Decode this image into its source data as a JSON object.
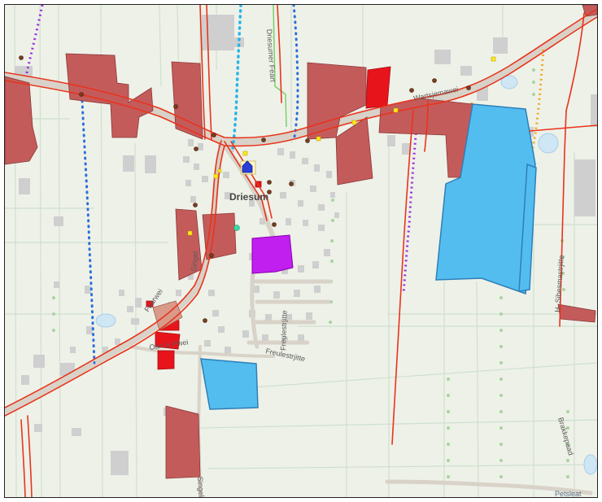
{
  "map": {
    "labels": {
      "town": "Driesum",
      "driesumer_feart": "Driesumer Feart",
      "singel_upper": "Singel",
      "singel_lower": "Singel",
      "foarwei": "Foarwei",
      "oanrein": "Oan 'e Pwei",
      "freulestrjitte": "Freulestrjitte",
      "wartsjemawei": "Wartsjemawei",
      "sibesmastrjitte": "H. Sibesmastrjitte",
      "brakkepaad": "Brakkepaad",
      "petsleat": "Petsleat"
    },
    "colors": {
      "background": "#eef1e8",
      "field_lines": "#cfe0cd",
      "road_casing": "#d8d2c8",
      "road_red": "#e8341c",
      "parcel_brown": "#c45b5b",
      "parcel_red": "#e8141c",
      "blue_area": "#53bdf0",
      "purple_area": "#c11ef0",
      "blue_dotted": "#2b6fdc",
      "cyan_dotted": "#27b4ea",
      "purple_cross": "#9b2de0",
      "orange_cross": "#f5a623",
      "green_line": "#7bd06c",
      "building": "#cfcfcf",
      "tree_dot": "#a8d4a0"
    },
    "point_symbols": [
      "brown-dot",
      "yellow-square",
      "red-square",
      "church-icon",
      "green-dot"
    ]
  }
}
